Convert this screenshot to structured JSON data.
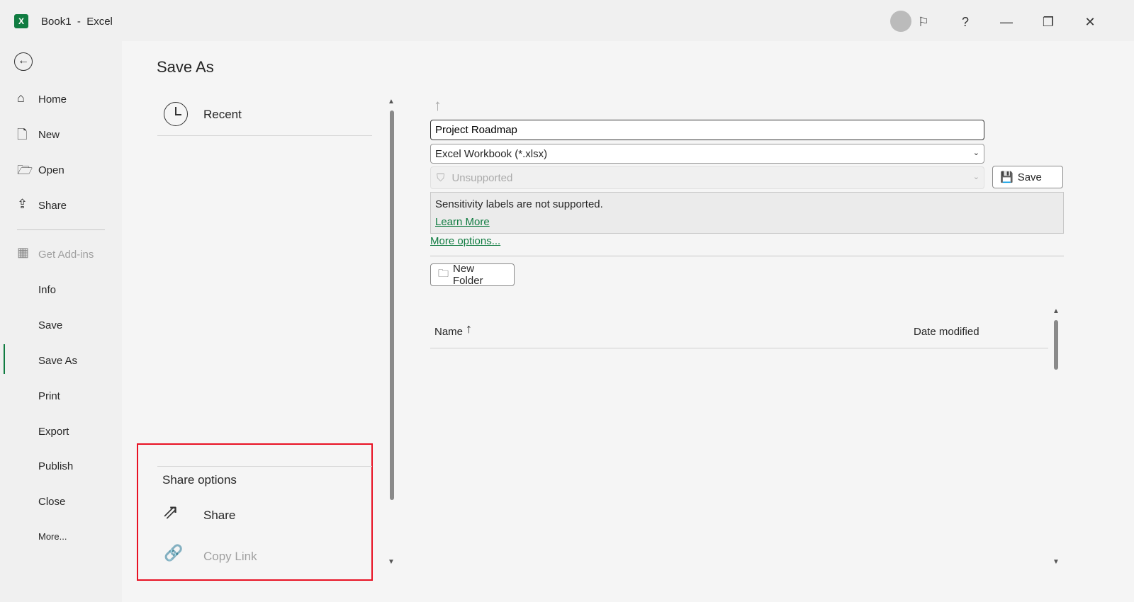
{
  "window": {
    "title": "Book1  -  Excel",
    "app_icon": "excel-logo"
  },
  "titlebar": {
    "icons": [
      "account-icon",
      "feedback-icon",
      "help-icon",
      "minimize-icon",
      "restore-icon",
      "close-icon"
    ],
    "help": "?"
  },
  "nav": {
    "back": "back-icon",
    "items": [
      {
        "label": "Home",
        "icon": "home-icon"
      },
      {
        "label": "New",
        "icon": "new-document-icon"
      },
      {
        "label": "Open",
        "icon": "folder-open-icon"
      },
      {
        "label": "Share",
        "icon": "share-icon"
      },
      {
        "label": "Get Add-ins",
        "icon": "addins-icon",
        "disabled": true
      },
      {
        "label": "Info"
      },
      {
        "label": "Save"
      },
      {
        "label": "Save As",
        "active": true
      },
      {
        "label": "Print"
      },
      {
        "label": "Export"
      },
      {
        "label": "Publish"
      },
      {
        "label": "Close"
      },
      {
        "label": "More..."
      }
    ]
  },
  "page": {
    "title": "Save As"
  },
  "locations": {
    "recent": "Recent",
    "share_options_title": "Share options",
    "share": "Share",
    "copy_link": "Copy Link"
  },
  "form": {
    "filename": "Project Roadmap",
    "filetype": "Excel Workbook (*.xlsx)",
    "sensitivity": "Unsupported",
    "save": "Save",
    "notice": "Sensitivity labels are not supported.",
    "learn_more": "Learn More",
    "more_options": "More options...",
    "new_folder": "New Folder"
  },
  "file_list": {
    "columns": [
      "Name",
      "Date modified"
    ],
    "sort": "ascending"
  },
  "colors": {
    "accent": "#107c41",
    "highlight_box": "#e81123"
  }
}
